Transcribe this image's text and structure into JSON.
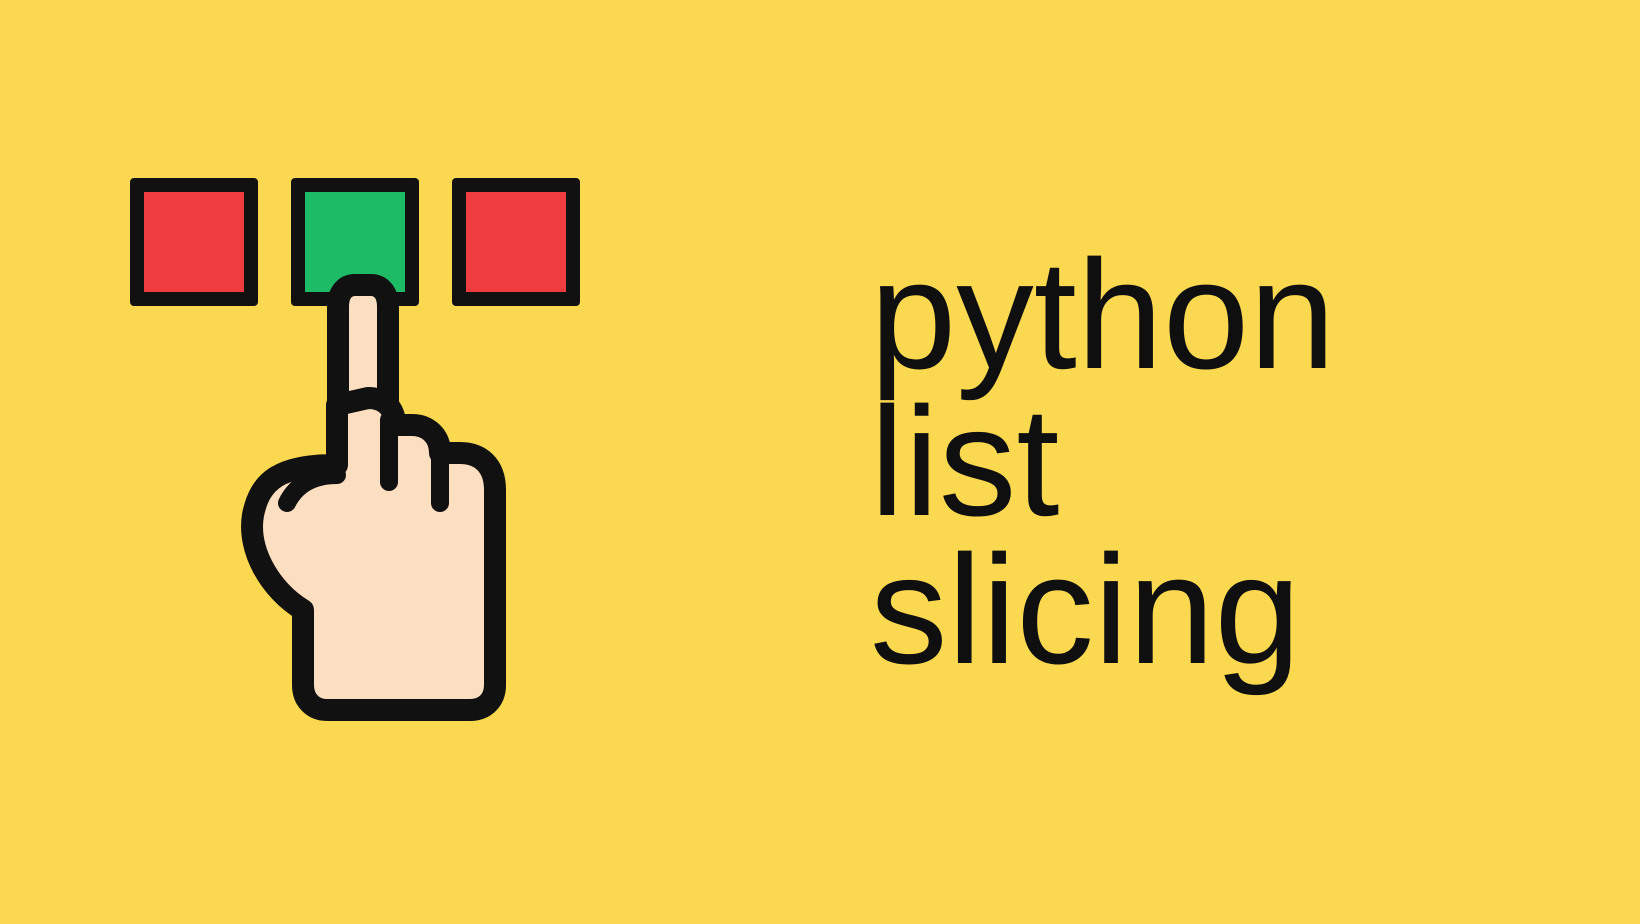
{
  "title": {
    "line1": "python",
    "line2": "list",
    "line3": "slicing"
  },
  "boxes": [
    {
      "color": "red",
      "selected": false
    },
    {
      "color": "green",
      "selected": true
    },
    {
      "color": "red",
      "selected": false
    }
  ],
  "colors": {
    "background": "#FAD84F",
    "red": "#EE3C3F",
    "green": "#1EBB67",
    "stroke": "#111111",
    "hand": "#FCDFC1"
  }
}
